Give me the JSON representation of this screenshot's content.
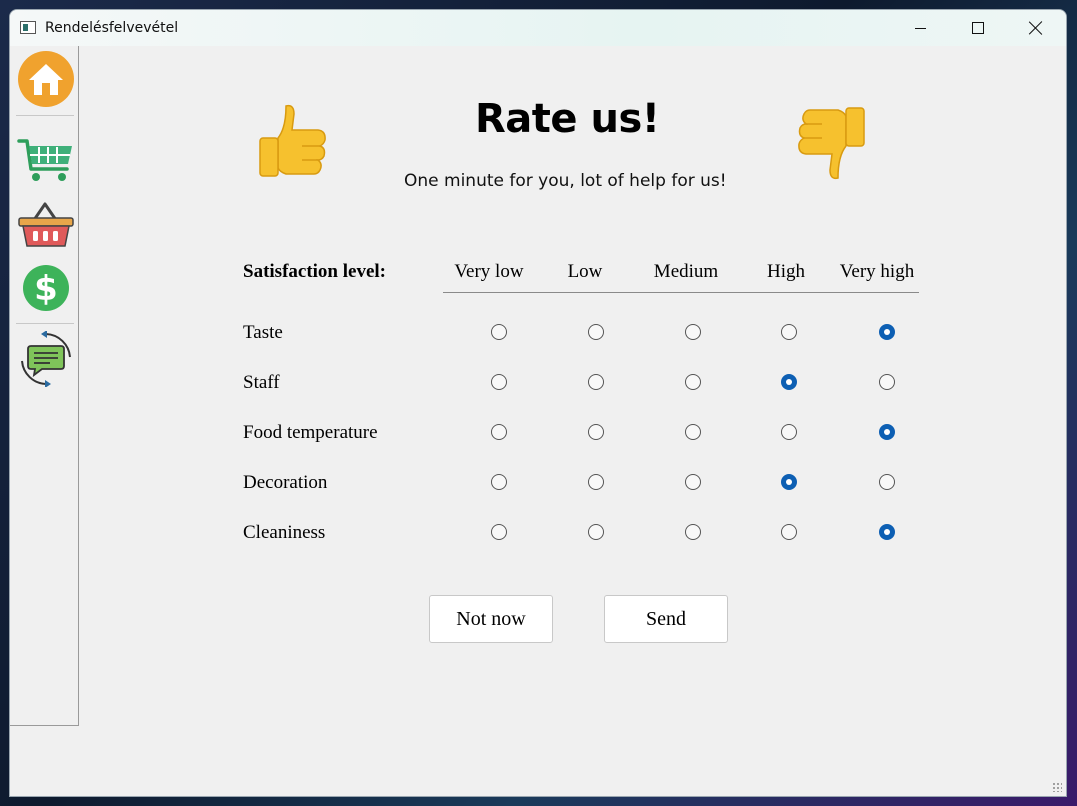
{
  "window": {
    "title": "Rendelésfelvevétel"
  },
  "sidebar": {
    "items": [
      {
        "name": "home",
        "icon": "home-icon"
      },
      {
        "name": "cart",
        "icon": "cart-icon"
      },
      {
        "name": "basket",
        "icon": "basket-icon"
      },
      {
        "name": "payment",
        "icon": "dollar-icon"
      },
      {
        "name": "feedback",
        "icon": "feedback-icon"
      }
    ]
  },
  "page": {
    "title": "Rate us!",
    "subtitle": "One minute for you, lot of help for us!"
  },
  "rating": {
    "header_label": "Satisfaction level:",
    "levels": [
      "Very low",
      "Low",
      "Medium",
      "High",
      "Very high"
    ],
    "criteria": [
      {
        "label": "Taste",
        "selected": "Very high"
      },
      {
        "label": "Staff",
        "selected": "High"
      },
      {
        "label": "Food temperature",
        "selected": "Very high"
      },
      {
        "label": "Decoration",
        "selected": "High"
      },
      {
        "label": "Cleaniness",
        "selected": "Very high"
      }
    ]
  },
  "actions": {
    "not_now": "Not now",
    "send": "Send"
  },
  "colors": {
    "accent": "#0d5fb3",
    "home": "#f0a22e",
    "cart": "#2e9e5b",
    "dollar": "#3db35a",
    "basket": "#e05a5a"
  }
}
